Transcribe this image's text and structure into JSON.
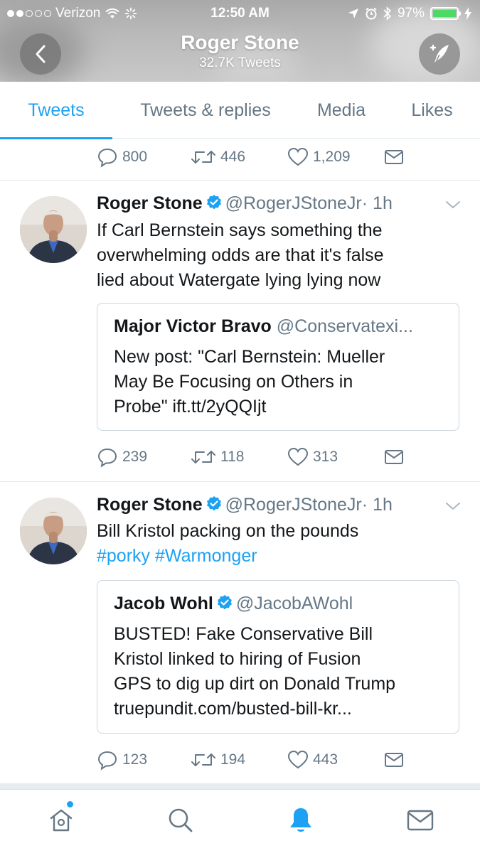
{
  "status_bar": {
    "carrier": "Verizon",
    "time": "12:50 AM",
    "battery": "97%"
  },
  "profile": {
    "name": "Roger Stone",
    "tweet_count": "32.7K Tweets"
  },
  "tabs": [
    {
      "label": "Tweets",
      "active": true
    },
    {
      "label": "Tweets & replies",
      "active": false
    },
    {
      "label": "Media",
      "active": false
    },
    {
      "label": "Likes",
      "active": false
    }
  ],
  "top_tweet_actions": {
    "replies": "800",
    "retweets": "446",
    "likes": "1,209"
  },
  "tweets": [
    {
      "author_name": "Roger Stone",
      "handle": "@RogerJStoneJr",
      "time": "· 1h",
      "text_lines": [
        "If Carl Bernstein says something the",
        "overwhelming odds are that it's false",
        "lied about Watergate lying lying now"
      ],
      "quote": {
        "name": "Major Victor Bravo",
        "handle": "@Conservatexi...",
        "text_lines": [
          "New post: \"Carl Bernstein: Mueller",
          "May Be Focusing on Others in",
          "Probe\" ift.tt/2yQQIjt"
        ]
      },
      "replies": "239",
      "retweets": "118",
      "likes": "313"
    },
    {
      "author_name": "Roger Stone",
      "handle": "@RogerJStoneJr",
      "time": "· 1h",
      "text_line_1": "Bill Kristol packing on the pounds",
      "hashtags": [
        "#porky",
        "#Warmonger"
      ],
      "quote": {
        "name": "Jacob Wohl",
        "handle": "@JacobAWohl",
        "text_lines": [
          "BUSTED! Fake Conservative Bill",
          "Kristol linked to hiring of Fusion",
          "GPS to dig up dirt on Donald Trump",
          "truepundit.com/busted-bill-kr..."
        ]
      },
      "replies": "123",
      "retweets": "194",
      "likes": "443"
    }
  ],
  "bottom_nav": [
    {
      "icon": "home-icon"
    },
    {
      "icon": "search-icon"
    },
    {
      "icon": "notifications-bell-icon"
    },
    {
      "icon": "messages-envelope-icon"
    }
  ],
  "colors": {
    "accent": "#1da1f2",
    "secondary_text": "#657786",
    "border": "#e1e8ed",
    "battery_green": "#4cd964"
  }
}
